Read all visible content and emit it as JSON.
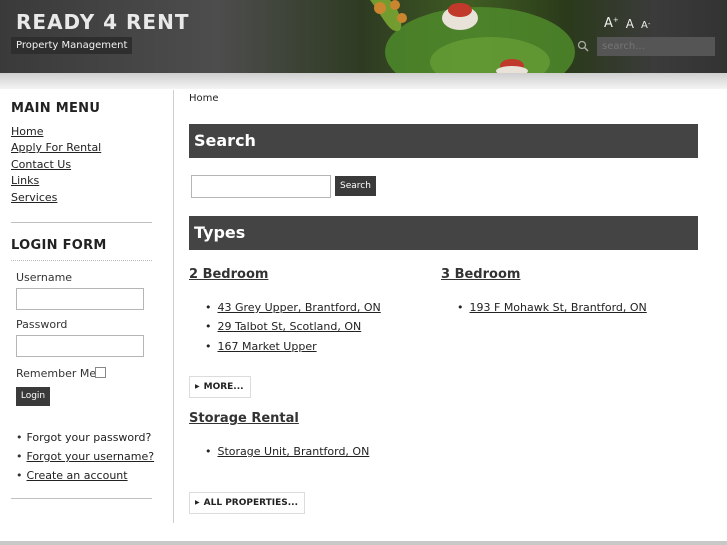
{
  "header": {
    "site_title": "READY 4 RENT",
    "slogan": "Property Management",
    "font_tools": {
      "increase": "A",
      "increase_sup": "+",
      "reset": "A",
      "decrease": "A",
      "decrease_sup": "-"
    },
    "search_placeholder": "search..."
  },
  "sidebar": {
    "main_menu": {
      "title": "MAIN MENU",
      "items": [
        {
          "label": "Home"
        },
        {
          "label": "Apply For Rental"
        },
        {
          "label": "Contact Us"
        },
        {
          "label": "Links"
        },
        {
          "label": "Services"
        }
      ]
    },
    "login_form": {
      "title": "LOGIN FORM",
      "username_label": "Username",
      "username_value": "",
      "password_label": "Password",
      "password_value": "",
      "remember_label": "Remember Me",
      "remember_checked": false,
      "login_button": "Login",
      "links": [
        {
          "label": "Forgot your password?"
        },
        {
          "label": "Forgot your username?"
        },
        {
          "label": "Create an account"
        }
      ]
    }
  },
  "main": {
    "breadcrumb": "Home",
    "search_section": {
      "title": "Search",
      "input_value": "",
      "button_label": "Search"
    },
    "types_section": {
      "title": "Types",
      "categories": [
        {
          "name": "2 Bedroom",
          "properties": [
            "43 Grey Upper, Brantford, ON",
            "29 Talbot St, Scotland, ON",
            "167 Market Upper"
          ]
        },
        {
          "name": "3 Bedroom",
          "properties": [
            "193 F Mohawk St, Brantford, ON"
          ]
        },
        {
          "name": "Storage Rental",
          "properties": [
            "Storage Unit, Brantford, ON"
          ]
        }
      ],
      "more_label": "MORE...",
      "all_properties_label": "ALL PROPERTIES..."
    }
  },
  "colors": {
    "section_bar": "#444444",
    "button_dark": "#3a3a3a",
    "header_dark": "#3a3a3a",
    "frog_green": "#4f8a2a"
  }
}
